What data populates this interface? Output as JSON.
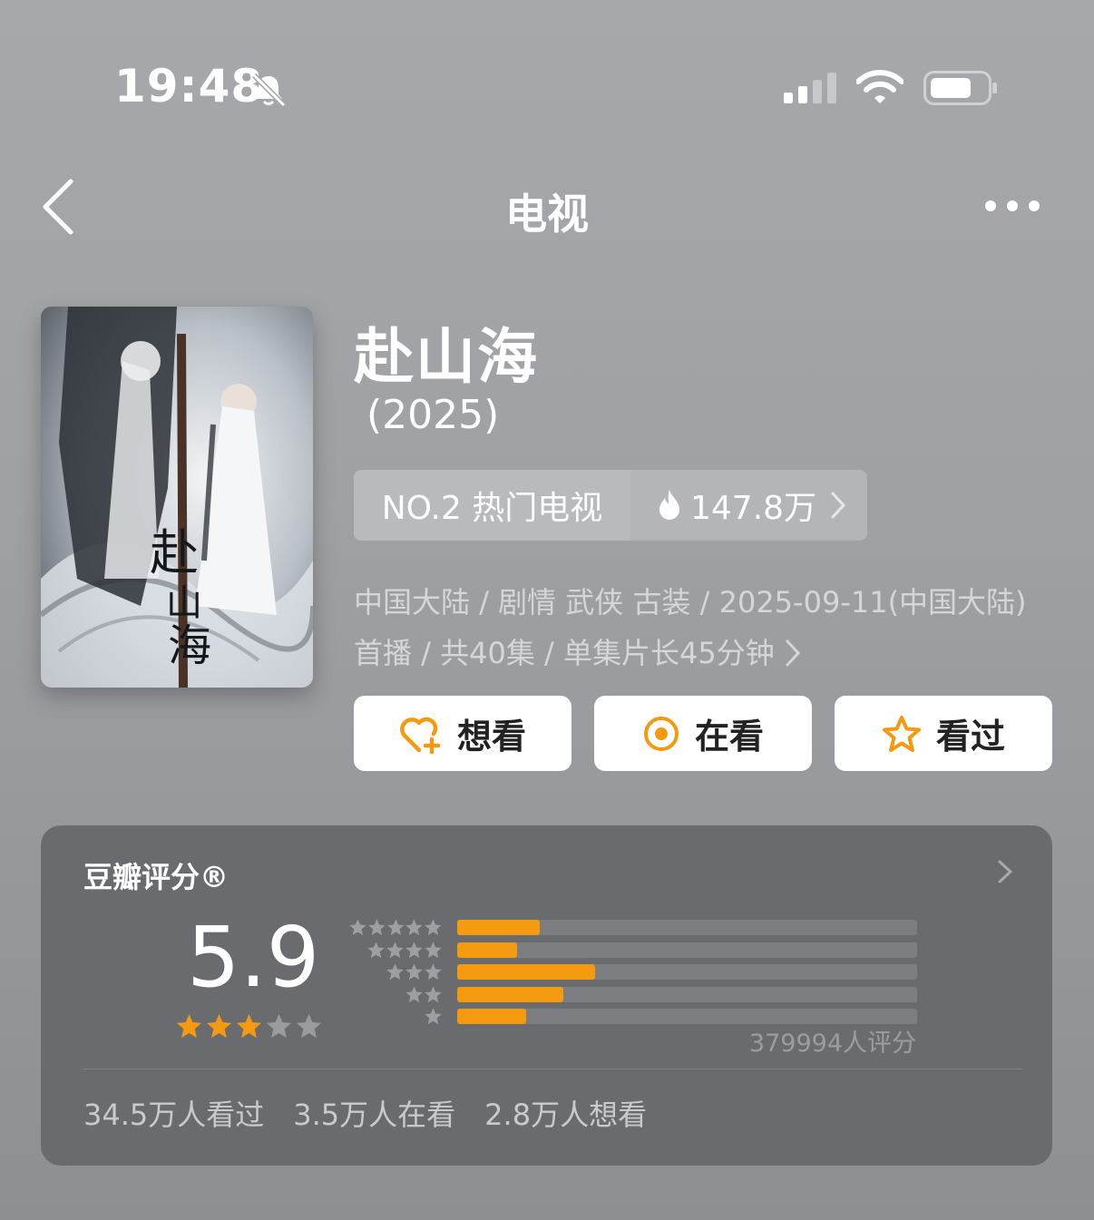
{
  "status_bar": {
    "time": "19:48"
  },
  "nav": {
    "title": "电视"
  },
  "movie": {
    "title": "赴山海",
    "year": "(2025)",
    "rank_label": "NO.2 热门电视",
    "heat": "147.8万",
    "meta_line1": "中国大陆 / 剧情 武侠 古装 / 2025-09-11(中国大陆)",
    "meta_line2": "首播 / 共40集 / 单集片长45分钟"
  },
  "actions": {
    "want": "想看",
    "watching": "在看",
    "watched": "看过"
  },
  "rating": {
    "title": "豆瓣评分®",
    "score": "5.9",
    "stars": 3,
    "max_stars": 5,
    "distribution": [
      {
        "stars": 5,
        "fraction": 0.18
      },
      {
        "stars": 4,
        "fraction": 0.13
      },
      {
        "stars": 3,
        "fraction": 0.3
      },
      {
        "stars": 2,
        "fraction": 0.23
      },
      {
        "stars": 1,
        "fraction": 0.15
      }
    ],
    "votes": "379994人评分",
    "watched_count": "34.5万人看过",
    "watching_count": "3.5万人在看",
    "want_count": "2.8万人想看"
  },
  "colors": {
    "accent": "#f39a10",
    "card": "#6a6b6e"
  }
}
